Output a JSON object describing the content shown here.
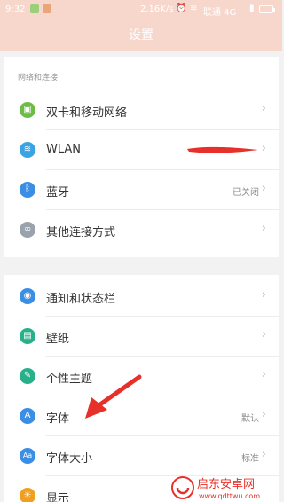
{
  "status": {
    "time": "9:32",
    "network_speed": "2.16K/s",
    "carrier": "联通 4G"
  },
  "header": {
    "title": "设置"
  },
  "sections": {
    "network_label": "网络和连接"
  },
  "rows": {
    "dual_sim": {
      "label": "双卡和移动网络",
      "icon": "sim-icon",
      "color": "#6dbd45"
    },
    "wlan": {
      "label": "WLAN",
      "icon": "wifi-icon",
      "color": "#3aa3e3"
    },
    "bluetooth": {
      "label": "蓝牙",
      "value": "已关闭",
      "icon": "bluetooth-icon",
      "color": "#3a8ee6"
    },
    "other": {
      "label": "其他连接方式",
      "icon": "link-icon",
      "color": "#9aa3ad"
    },
    "notifications": {
      "label": "通知和状态栏",
      "icon": "toggle-icon",
      "color": "#3a8ee6"
    },
    "wallpaper": {
      "label": "壁纸",
      "icon": "image-icon",
      "color": "#27b08a"
    },
    "themes": {
      "label": "个性主题",
      "icon": "theme-icon",
      "color": "#27b08a"
    },
    "font": {
      "label": "字体",
      "value": "默认",
      "icon": "font-icon",
      "color": "#3a8ee6"
    },
    "font_size": {
      "label": "字体大小",
      "value": "标准",
      "icon": "font-size-icon",
      "color": "#3a8ee6"
    },
    "display": {
      "label": "显示",
      "icon": "display-icon",
      "color": "#f0a020"
    }
  },
  "watermark": {
    "brand": "启东安卓网",
    "url": "www.qdttwu.com"
  },
  "colors": {
    "header_bg": "#f7d7cc",
    "annotation_red": "#e8302a"
  }
}
